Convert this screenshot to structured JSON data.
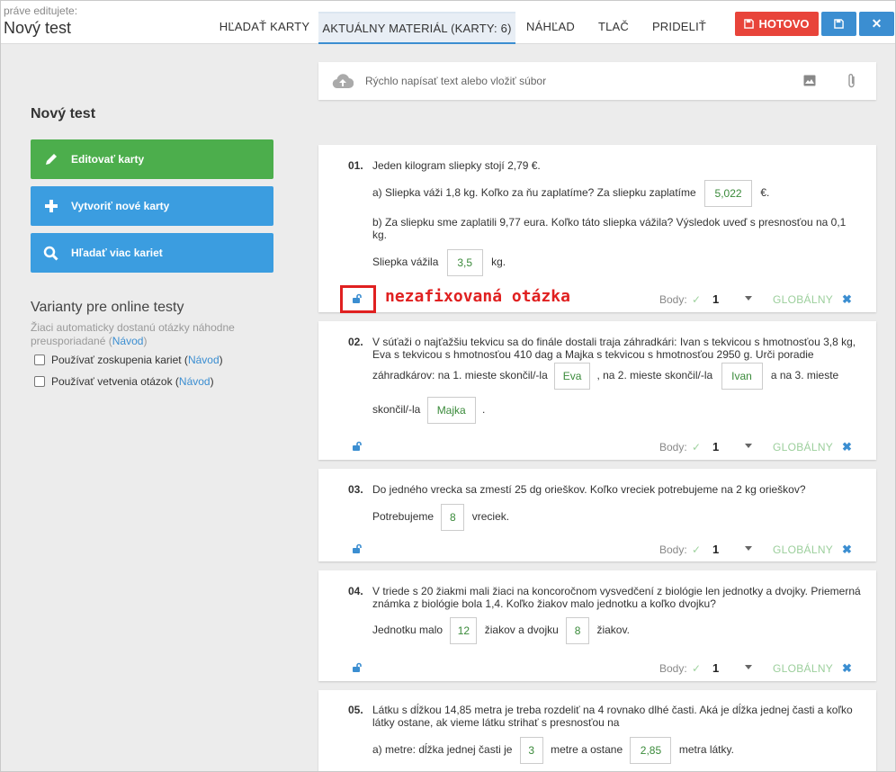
{
  "header": {
    "editing_label": "práve editujete:",
    "title": "Nový test",
    "tabs": [
      {
        "label": "HĽADAŤ KARTY",
        "active": false
      },
      {
        "label": "AKTUÁLNY MATERIÁL (KARTY: 6)",
        "active": true
      },
      {
        "label": "NÁHĽAD",
        "active": false
      },
      {
        "label": "TLAČ",
        "active": false
      },
      {
        "label": "PRIDELIŤ",
        "active": false
      }
    ],
    "done_label": "HOTOVO",
    "save_icon": "floppy-icon",
    "close_icon": "close-icon",
    "colors": {
      "done": "#e8443a",
      "primary": "#3b8ed1"
    }
  },
  "sidebar": {
    "title": "Nový test",
    "buttons": [
      {
        "label": "Editovať karty",
        "icon": "pencil-icon",
        "color": "#4cae4c"
      },
      {
        "label": "Vytvoriť nové karty",
        "icon": "plus-icon",
        "color": "#3b9de0"
      },
      {
        "label": "Hľadať viac kariet",
        "icon": "search-icon",
        "color": "#3b9de0"
      }
    ],
    "variants_title": "Varianty pre online testy",
    "variants_desc": "Žiaci automaticky dostanú otázky náhodne preusporiadané",
    "help_link": "Návod",
    "options": [
      {
        "label": "Používať zoskupenia kariet",
        "checked": false
      },
      {
        "label": "Používať vetvenia otázok",
        "checked": false
      }
    ]
  },
  "quick_input": {
    "placeholder": "Rýchlo napísať text alebo vložiť súbor",
    "icons": [
      "cloud-upload-icon",
      "image-icon",
      "paperclip-icon"
    ]
  },
  "card_footer": {
    "points_label": "Body:",
    "global_label": "GLOBÁLNY"
  },
  "annotation": "nezafixovaná otázka",
  "cards": [
    {
      "number": "01.",
      "text": "Jeden kilogram sliepky stojí 2,79 €.",
      "a_text": "a) Sliepka váži 1,8 kg. Koľko za ňu zaplatíme? Za sliepku zaplatíme",
      "a_answer": "5,022",
      "a_unit": "€.",
      "b_text": "b) Za sliepku sme zaplatili 9,77 eura. Koľko táto sliepka vážila? Výsledok uveď s presnosťou na 0,1 kg.",
      "b2_text": "Sliepka vážila",
      "b_answer": "3,5",
      "b_unit": "kg.",
      "points": "1"
    },
    {
      "number": "02.",
      "text": "V súťaži o najťažšiu tekvicu sa do finále dostali traja záhradkári: Ivan s tekvicou s hmotnosťou 3,8 kg, Eva s tekvicou s hmotnosťou 410 dag a Majka s tekvicou s hmotnosťou 2950 g. Urči poradie",
      "p1": "záhradkárov: na 1. mieste skončil/-la",
      "ans1": "Eva",
      "p2": ", na 2. mieste skončil/-la",
      "ans2": "Ivan",
      "p3": "a na 3. mieste",
      "p4": "skončil/-la",
      "ans3": "Majka",
      "p5": ".",
      "points": "1"
    },
    {
      "number": "03.",
      "text": "Do jedného vrecka sa zmestí 25 dg orieškov. Koľko vreciek potrebujeme na 2 kg orieškov?",
      "p1": "Potrebujeme",
      "ans1": "8",
      "p2": "vreciek.",
      "points": "1"
    },
    {
      "number": "04.",
      "text": "V triede s 20 žiakmi mali žiaci na koncoročnom vysvedčení z biológie len jednotky a dvojky. Priemerná známka z biológie bola 1,4. Koľko žiakov malo jednotku a koľko dvojku?",
      "p1": "Jednotku malo",
      "ans1": "12",
      "p2": "žiakov a dvojku",
      "ans2": "8",
      "p3": "žiakov.",
      "points": "1"
    },
    {
      "number": "05.",
      "text": "Látku s dĺžkou 14,85 metra je treba rozdeliť na 4 rovnako dlhé časti. Aká je dĺžka jednej časti a koľko látky ostane, ak vieme látku strihať s presnosťou na",
      "p1": "a) metre: dĺžka jednej časti je",
      "ans1": "3",
      "p2": "metre a ostane",
      "ans2": "2,85",
      "p3": "metra látky."
    }
  ]
}
